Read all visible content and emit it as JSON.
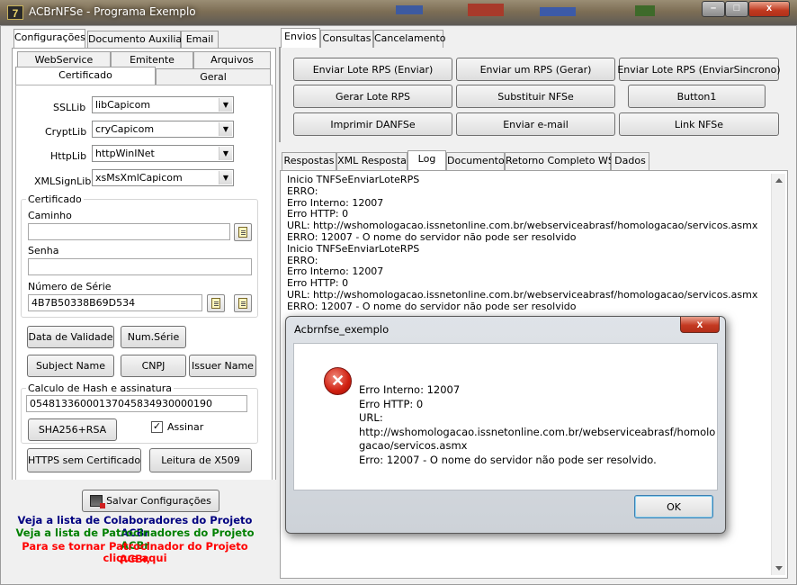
{
  "window": {
    "title": "ACBrNFSe - Programa Exemplo",
    "icon_text": "7"
  },
  "left_tabs": [
    "Configurações",
    "Documento Auxiliar",
    "Email"
  ],
  "sub_tabs_row1": [
    "WebService",
    "Emitente",
    "Arquivos"
  ],
  "sub_tabs_row2": [
    "Certificado",
    "Geral"
  ],
  "cert": {
    "ssllib_label": "SSLLib",
    "ssllib_value": "libCapicom",
    "cryptlib_label": "CryptLib",
    "cryptlib_value": "cryCapicom",
    "httplib_label": "HttpLib",
    "httplib_value": "httpWinINet",
    "xmlsignlib_label": "XMLSignLib",
    "xmlsignlib_value": "xsMsXmlCapicom",
    "group_title": "Certificado",
    "caminho_label": "Caminho",
    "caminho_value": "",
    "senha_label": "Senha",
    "senha_value": "",
    "serie_label": "Número de Série",
    "serie_value": "4B7B50338B69D534",
    "btn_validade": "Data de Validade",
    "btn_numserie": "Num.Série",
    "btn_subject": "Subject Name",
    "btn_cnpj": "CNPJ",
    "btn_issuer": "Issuer Name",
    "hash_title": "Calculo de Hash e assinatura",
    "hash_value": "05481336000137045834930000190",
    "btn_sha": "SHA256+RSA",
    "assinar_label": "Assinar",
    "assinar_checked": true,
    "btn_https": "HTTPS sem Certificado",
    "btn_x509": "Leitura de X509"
  },
  "save_button": "Salvar Configurações",
  "links": {
    "colab": "Veja a lista de Colaboradores do Projeto ACBr",
    "patro": "Veja a lista de Patrocinadores do Projeto ACBr",
    "become1": "Para se tornar Patrocinador do Projeto ACBr,",
    "become2": "clique aqui",
    "colors": {
      "colab": "#000080",
      "patro": "#008000",
      "become": "#ff0000"
    }
  },
  "right_tabs": [
    "Envios",
    "Consultas",
    "Cancelamento"
  ],
  "action_buttons": [
    [
      "Enviar Lote RPS (Enviar)",
      "Enviar um RPS (Gerar)",
      "Enviar Lote RPS (EnviarSincrono)"
    ],
    [
      "Gerar Lote RPS",
      "Substituir NFSe",
      "Button1"
    ],
    [
      "Imprimir DANFSe",
      "Enviar e-mail",
      "Link NFSe"
    ]
  ],
  "result_tabs": [
    "Respostas",
    "XML Resposta",
    "Log",
    "Documento",
    "Retorno Completo WS",
    "Dados"
  ],
  "log_lines": [
    "Inicio TNFSeEnviarLoteRPS",
    "ERRO:",
    "Erro Interno: 12007",
    "Erro HTTP: 0",
    "URL: http://wshomologacao.issnetonline.com.br/webserviceabrasf/homologacao/servicos.asmx",
    "ERRO: 12007 - O nome do servidor não pode ser resolvido",
    "Inicio TNFSeEnviarLoteRPS",
    "ERRO:",
    "Erro Interno: 12007",
    "Erro HTTP: 0",
    "URL: http://wshomologacao.issnetonline.com.br/webserviceabrasf/homologacao/servicos.asmx",
    "ERRO: 12007 - O nome do servidor não pode ser resolvido"
  ],
  "dialog": {
    "title": "Acbrnfse_exemplo",
    "message": "Erro Interno: 12007\nErro HTTP: 0\nURL:\nhttp://wshomologacao.issnetonline.com.br/webserviceabrasf/homolo\ngacao/servicos.asmx\nErro: 12007 - O nome do servidor não pode ser resolvido.",
    "ok": "OK",
    "close_glyph": "x",
    "icon": "error-icon"
  },
  "window_controls": {
    "minimize": "–",
    "maximize": "□",
    "close": "x"
  }
}
